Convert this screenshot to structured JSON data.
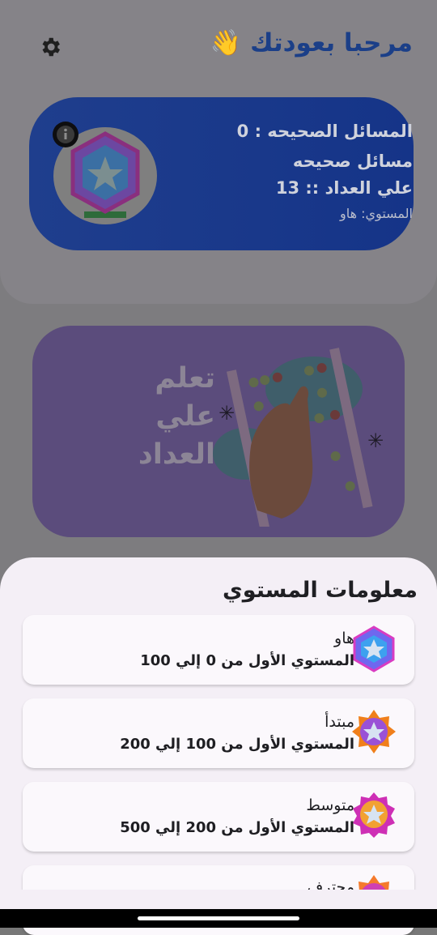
{
  "header": {
    "greeting": "مرحبا بعودتك 👋"
  },
  "stats": {
    "correct_problems": "المسائل الصحيحه : 0",
    "abacus_correct_line1": "مسائل صحيحه",
    "abacus_correct_line2": "علي العداد :: 13",
    "level": "المستوي: هاو"
  },
  "learn": {
    "lines": [
      "تعلم",
      "علي",
      "العداد"
    ]
  },
  "sheet": {
    "title": "معلومات المستوي",
    "levels": [
      {
        "name": "هاو",
        "range": "المستوي الأول من 0 إلي 100"
      },
      {
        "name": "مبتدأ",
        "range": "المستوي الأول من 100 إلي 200"
      },
      {
        "name": "متوسط",
        "range": "المستوي الأول من 200 إلي 500"
      },
      {
        "name": "محترف",
        "range": ""
      }
    ]
  },
  "colors": {
    "primary_blue": "#1f3e8d",
    "learn_purple": "#5b4c7c",
    "sheet_bg": "#f4eff6"
  }
}
